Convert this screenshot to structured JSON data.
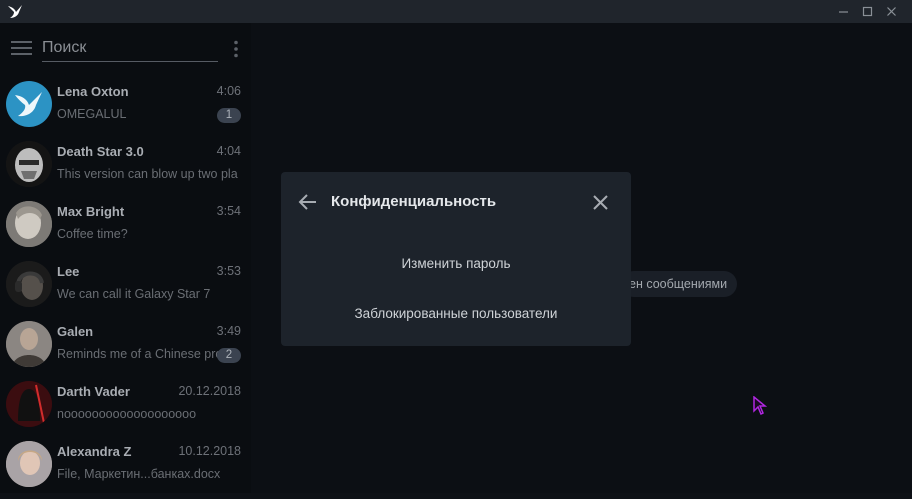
{
  "window": {
    "controls": [
      "minimize",
      "maximize",
      "close"
    ]
  },
  "sidebar": {
    "search_placeholder": "Поиск",
    "chats": [
      {
        "name": "Lena Oxton",
        "time": "4:06",
        "preview": "OMEGALUL",
        "unread": "1",
        "avatar": "swallow-logo-avatar"
      },
      {
        "name": "Death Star 3.0",
        "time": "4:04",
        "preview": "This version can blow up two pla",
        "unread": "",
        "avatar": "death-star-avatar"
      },
      {
        "name": "Max Bright",
        "time": "3:54",
        "preview": "Coffee time?",
        "unread": "",
        "avatar": "statue-avatar"
      },
      {
        "name": "Lee",
        "time": "3:53",
        "preview": "We can call it Galaxy Star 7",
        "unread": "",
        "avatar": "headphones-avatar"
      },
      {
        "name": "Galen",
        "time": "3:49",
        "preview": "Reminds me of a Chinese pro",
        "unread": "2",
        "avatar": "man-avatar"
      },
      {
        "name": "Darth Vader",
        "time": "20.12.2018",
        "preview": "nooooooooooooooooooo",
        "unread": "",
        "avatar": "vader-avatar"
      },
      {
        "name": "Alexandra Z",
        "time": "10.12.2018",
        "preview": "File, Маркетин...банках.docx",
        "unread": "",
        "avatar": "girl-avatar"
      }
    ]
  },
  "main": {
    "service_message": "ен сообщениями"
  },
  "dialog": {
    "title": "Конфиденциальность",
    "options": [
      "Изменить пароль",
      "Заблокированные пользователи"
    ]
  },
  "colors": {
    "accent": "#2ea6d9",
    "cursor": "#b027e0"
  }
}
